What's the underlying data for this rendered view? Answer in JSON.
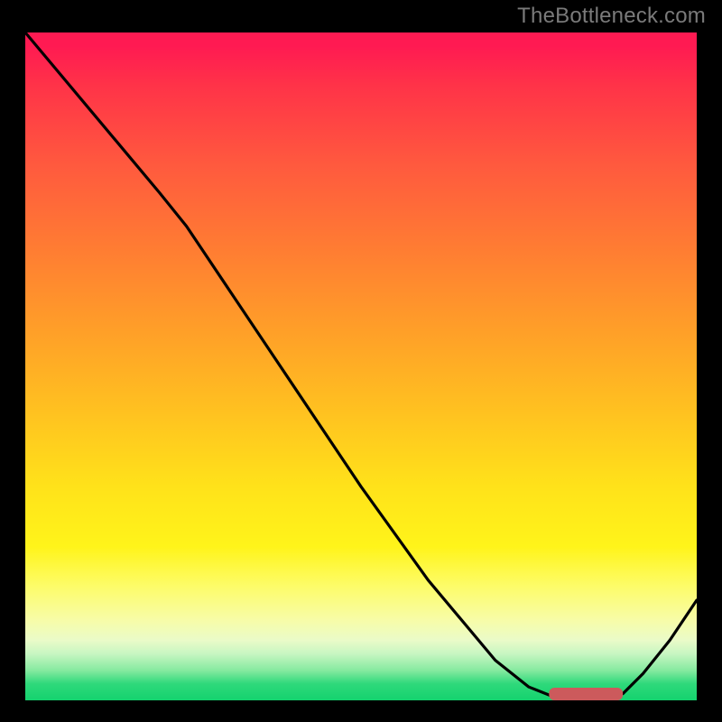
{
  "attribution": "TheBottleneck.com",
  "chart_data": {
    "type": "line",
    "title": "",
    "xlabel": "",
    "ylabel": "",
    "xlim": [
      0,
      100
    ],
    "ylim": [
      0,
      100
    ],
    "series": [
      {
        "name": "bottleneck-curve",
        "x": [
          0,
          5,
          10,
          15,
          20,
          24,
          30,
          40,
          50,
          60,
          70,
          75,
          80,
          83,
          86,
          89,
          92,
          96,
          100
        ],
        "y": [
          100,
          94,
          88,
          82,
          76,
          71,
          62,
          47,
          32,
          18,
          6,
          2,
          0,
          0,
          0,
          1,
          4,
          9,
          15
        ]
      }
    ],
    "highlight": {
      "name": "optimal-range-marker",
      "x_start": 78,
      "x_end": 89,
      "y": 0
    },
    "background_gradient": {
      "top_color": "#ff1a52",
      "mid_color": "#ffe21a",
      "bottom_color": "#14d26e"
    }
  }
}
